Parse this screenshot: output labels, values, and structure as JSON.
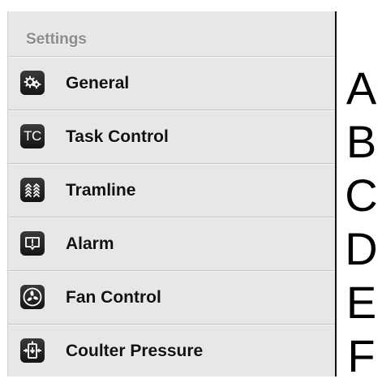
{
  "settings": {
    "header": "Settings",
    "items": [
      {
        "label": "General",
        "icon": "gears-icon"
      },
      {
        "label": "Task Control",
        "icon": "task-control-icon",
        "icon_text": "TC"
      },
      {
        "label": "Tramline",
        "icon": "tramline-icon"
      },
      {
        "label": "Alarm",
        "icon": "alarm-icon"
      },
      {
        "label": "Fan Control",
        "icon": "fan-icon"
      },
      {
        "label": "Coulter Pressure",
        "icon": "coulter-pressure-icon"
      }
    ]
  },
  "annotations": [
    "A",
    "B",
    "C",
    "D",
    "E",
    "F"
  ]
}
